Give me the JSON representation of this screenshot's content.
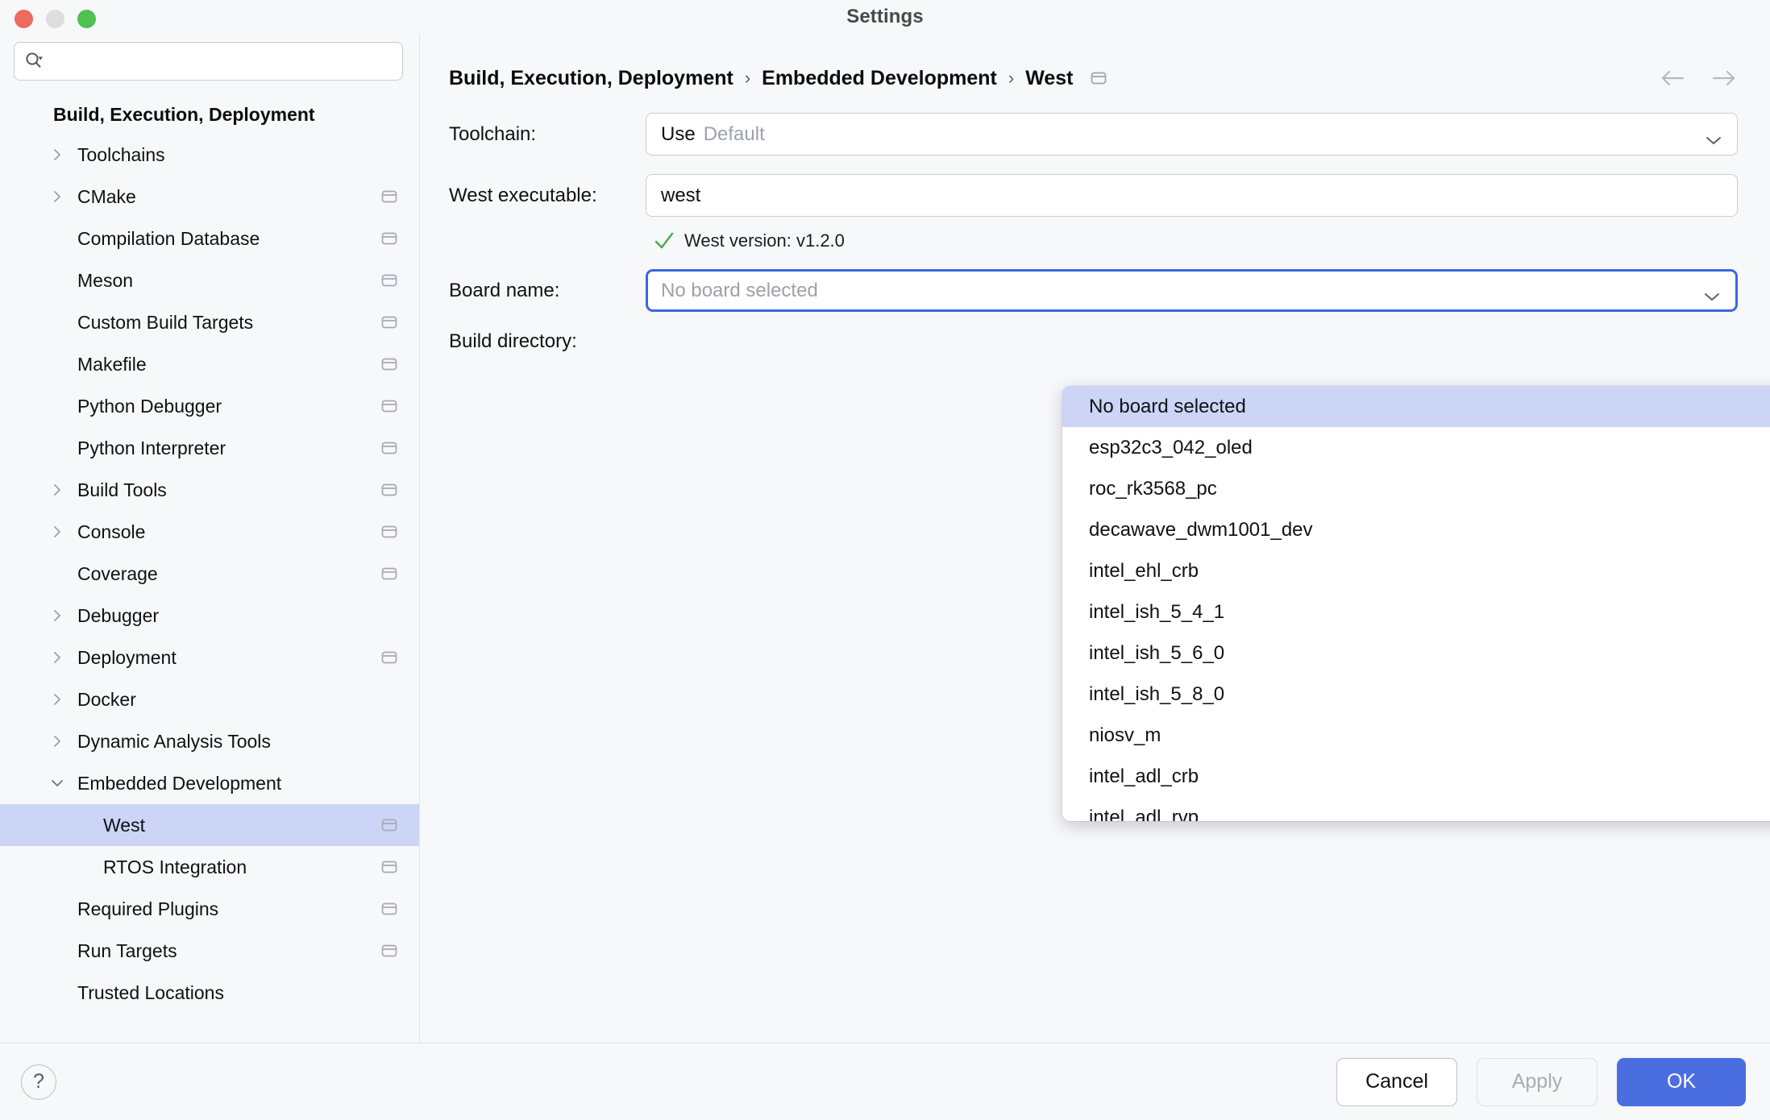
{
  "window": {
    "title": "Settings",
    "controls": [
      "close",
      "minimize",
      "maximize"
    ]
  },
  "sidebar": {
    "search": {
      "value": "",
      "placeholder": ""
    },
    "group_title": "Build, Execution, Deployment",
    "items": [
      {
        "label": "Toolchains",
        "indent": 0,
        "twisty": "right",
        "badge": false,
        "selected": false
      },
      {
        "label": "CMake",
        "indent": 0,
        "twisty": "right",
        "badge": true,
        "selected": false
      },
      {
        "label": "Compilation Database",
        "indent": 0,
        "twisty": "none",
        "badge": true,
        "selected": false
      },
      {
        "label": "Meson",
        "indent": 0,
        "twisty": "none",
        "badge": true,
        "selected": false
      },
      {
        "label": "Custom Build Targets",
        "indent": 0,
        "twisty": "none",
        "badge": true,
        "selected": false
      },
      {
        "label": "Makefile",
        "indent": 0,
        "twisty": "none",
        "badge": true,
        "selected": false
      },
      {
        "label": "Python Debugger",
        "indent": 0,
        "twisty": "none",
        "badge": true,
        "selected": false
      },
      {
        "label": "Python Interpreter",
        "indent": 0,
        "twisty": "none",
        "badge": true,
        "selected": false
      },
      {
        "label": "Build Tools",
        "indent": 0,
        "twisty": "right",
        "badge": true,
        "selected": false
      },
      {
        "label": "Console",
        "indent": 0,
        "twisty": "right",
        "badge": true,
        "selected": false
      },
      {
        "label": "Coverage",
        "indent": 0,
        "twisty": "none",
        "badge": true,
        "selected": false
      },
      {
        "label": "Debugger",
        "indent": 0,
        "twisty": "right",
        "badge": false,
        "selected": false
      },
      {
        "label": "Deployment",
        "indent": 0,
        "twisty": "right",
        "badge": true,
        "selected": false
      },
      {
        "label": "Docker",
        "indent": 0,
        "twisty": "right",
        "badge": false,
        "selected": false
      },
      {
        "label": "Dynamic Analysis Tools",
        "indent": 0,
        "twisty": "right",
        "badge": false,
        "selected": false
      },
      {
        "label": "Embedded Development",
        "indent": 0,
        "twisty": "down",
        "badge": false,
        "selected": false
      },
      {
        "label": "West",
        "indent": 1,
        "twisty": "none",
        "badge": true,
        "selected": true
      },
      {
        "label": "RTOS Integration",
        "indent": 1,
        "twisty": "none",
        "badge": true,
        "selected": false
      },
      {
        "label": "Required Plugins",
        "indent": 0,
        "twisty": "none",
        "badge": true,
        "selected": false
      },
      {
        "label": "Run Targets",
        "indent": 0,
        "twisty": "none",
        "badge": true,
        "selected": false
      },
      {
        "label": "Trusted Locations",
        "indent": 0,
        "twisty": "none",
        "badge": false,
        "selected": false
      }
    ]
  },
  "breadcrumb": {
    "parts": [
      "Build, Execution, Deployment",
      "Embedded Development",
      "West"
    ],
    "separator": "›",
    "has_project_badge": true,
    "back_label": "Back",
    "forward_label": "Forward"
  },
  "form": {
    "toolchain": {
      "label": "Toolchain:",
      "prefix": "Use",
      "value": "Default",
      "value_is_placeholder": true
    },
    "west_executable": {
      "label": "West executable:",
      "value": "west",
      "placeholder": ""
    },
    "west_version_status": {
      "icon": "check-icon",
      "text": "West version: v1.2.0",
      "color": "#4caf50"
    },
    "board_name": {
      "label": "Board name:",
      "value": "",
      "placeholder": "No board selected",
      "focused": true,
      "expanded": true
    },
    "build_directory": {
      "label": "Build directory:",
      "value": ""
    }
  },
  "dropdown": {
    "selected_index": 0,
    "options": [
      "No board selected",
      "esp32c3_042_oled",
      "roc_rk3568_pc",
      "decawave_dwm1001_dev",
      "intel_ehl_crb",
      "intel_ish_5_4_1",
      "intel_ish_5_6_0",
      "intel_ish_5_8_0",
      "niosv_m",
      "intel_adl_crb",
      "intel_adl_rvp"
    ]
  },
  "footer": {
    "help_label": "?",
    "cancel_label": "Cancel",
    "apply_label": "Apply",
    "apply_enabled": false,
    "ok_label": "OK"
  },
  "colors": {
    "accent": "#4a6ee0",
    "selection": "#ccd5f5",
    "focus_ring": "#3a66e0",
    "status_ok": "#4caf50",
    "window_bg": "#f7f8fa",
    "field_bg": "#ffffff",
    "border": "#c8cbd4"
  }
}
